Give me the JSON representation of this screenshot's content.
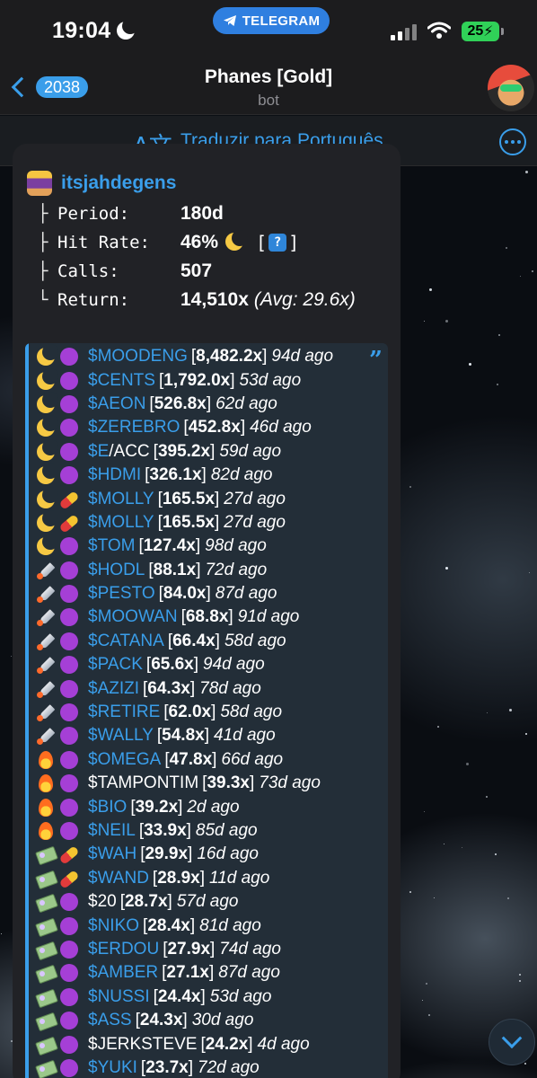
{
  "status_bar": {
    "time": "19:04",
    "pill": "TELEGRAM",
    "battery": "25"
  },
  "header": {
    "back_count": "2038",
    "title": "Phanes [Gold]",
    "subtitle": "bot"
  },
  "translate_bar": {
    "icon": "translate-icon",
    "label": "Traduzir para Português"
  },
  "message": {
    "sender": "itsjahdegens",
    "stats": [
      {
        "prefix": "├",
        "label": "Period:",
        "value": "180d"
      },
      {
        "prefix": "├",
        "label": "Hit Rate:",
        "value": "46%",
        "badge_open": "[",
        "badge": "?",
        "badge_close": "]"
      },
      {
        "prefix": "├",
        "label": "Calls:",
        "value": "507"
      },
      {
        "prefix": "└",
        "label": "Return:",
        "value": "14,510x",
        "avg": "(Avg: 29.6x)"
      }
    ],
    "calls": [
      {
        "icon1": "moon",
        "icon2": "purple",
        "ticker": "$MOODENG",
        "mult": "8,482.2x",
        "ago": "94d ago"
      },
      {
        "icon1": "moon",
        "icon2": "purple",
        "ticker": "$CENTS",
        "mult": "1,792.0x",
        "ago": "53d ago"
      },
      {
        "icon1": "moon",
        "icon2": "purple",
        "ticker": "$AEON",
        "mult": "526.8x",
        "ago": "62d ago"
      },
      {
        "icon1": "moon",
        "icon2": "purple",
        "ticker": "$ZEREBRO",
        "mult": "452.8x",
        "ago": "46d ago"
      },
      {
        "icon1": "moon",
        "icon2": "purple",
        "ticker": "$E",
        "ticker_rest": "/ACC",
        "mult": "395.2x",
        "ago": "59d ago"
      },
      {
        "icon1": "moon",
        "icon2": "purple",
        "ticker": "$HDMI",
        "mult": "326.1x",
        "ago": "82d ago"
      },
      {
        "icon1": "moon",
        "icon2": "pill",
        "ticker": "$MOLLY",
        "mult": "165.5x",
        "ago": "27d ago"
      },
      {
        "icon1": "moon",
        "icon2": "pill",
        "ticker": "$MOLLY",
        "mult": "165.5x",
        "ago": "27d ago"
      },
      {
        "icon1": "moon",
        "icon2": "purple",
        "ticker": "$TOM",
        "mult": "127.4x",
        "ago": "98d ago"
      },
      {
        "icon1": "rocket",
        "icon2": "purple",
        "ticker": "$HODL",
        "mult": "88.1x",
        "ago": "72d ago"
      },
      {
        "icon1": "rocket",
        "icon2": "purple",
        "ticker": "$PESTO",
        "mult": "84.0x",
        "ago": "87d ago"
      },
      {
        "icon1": "rocket",
        "icon2": "purple",
        "ticker": "$MOOWAN",
        "mult": "68.8x",
        "ago": "91d ago"
      },
      {
        "icon1": "rocket",
        "icon2": "purple",
        "ticker": "$CATANA",
        "mult": "66.4x",
        "ago": "58d ago"
      },
      {
        "icon1": "rocket",
        "icon2": "purple",
        "ticker": "$PACK",
        "mult": "65.6x",
        "ago": "94d ago"
      },
      {
        "icon1": "rocket",
        "icon2": "purple",
        "ticker": "$AZIZI",
        "mult": "64.3x",
        "ago": "78d ago"
      },
      {
        "icon1": "rocket",
        "icon2": "purple",
        "ticker": "$RETIRE",
        "mult": "62.0x",
        "ago": "58d ago"
      },
      {
        "icon1": "rocket",
        "icon2": "purple",
        "ticker": "$WALLY",
        "mult": "54.8x",
        "ago": "41d ago"
      },
      {
        "icon1": "fire",
        "icon2": "purple",
        "ticker": "$OMEGA",
        "mult": "47.8x",
        "ago": "66d ago"
      },
      {
        "icon1": "fire",
        "icon2": "purple",
        "ticker": "$TAMPONTIM",
        "plain": true,
        "mult": "39.3x",
        "ago": "73d ago"
      },
      {
        "icon1": "fire",
        "icon2": "purple",
        "ticker": "$BIO",
        "mult": "39.2x",
        "ago": "2d ago"
      },
      {
        "icon1": "fire",
        "icon2": "purple",
        "ticker": "$NEIL",
        "mult": "33.9x",
        "ago": "85d ago"
      },
      {
        "icon1": "cash",
        "icon2": "pill",
        "ticker": "$WAH",
        "mult": "29.9x",
        "ago": "16d ago"
      },
      {
        "icon1": "cash",
        "icon2": "pill",
        "ticker": "$WAND",
        "mult": "28.9x",
        "ago": "11d ago"
      },
      {
        "icon1": "cash",
        "icon2": "purple",
        "ticker": "$20",
        "plain": true,
        "mult": "28.7x",
        "ago": "57d ago"
      },
      {
        "icon1": "cash",
        "icon2": "purple",
        "ticker": "$NIKO",
        "mult": "28.4x",
        "ago": "81d ago"
      },
      {
        "icon1": "cash",
        "icon2": "purple",
        "ticker": "$ERDOU",
        "mult": "27.9x",
        "ago": "74d ago"
      },
      {
        "icon1": "cash",
        "icon2": "purple",
        "ticker": "$AMBER",
        "mult": "27.1x",
        "ago": "87d ago"
      },
      {
        "icon1": "cash",
        "icon2": "purple",
        "ticker": "$NUSSI",
        "mult": "24.4x",
        "ago": "53d ago"
      },
      {
        "icon1": "cash",
        "icon2": "purple",
        "ticker": "$ASS",
        "mult": "24.3x",
        "ago": "30d ago"
      },
      {
        "icon1": "cash",
        "icon2": "purple",
        "ticker": "$JERKSTEVE",
        "plain": true,
        "mult": "24.2x",
        "ago": "4d ago"
      },
      {
        "icon1": "cash",
        "icon2": "purple",
        "ticker": "$YUKI",
        "mult": "23.7x",
        "ago": "72d ago"
      }
    ]
  },
  "colors": {
    "accent": "#3a9eea",
    "bubble": "#212226",
    "quote": "#232e38"
  }
}
